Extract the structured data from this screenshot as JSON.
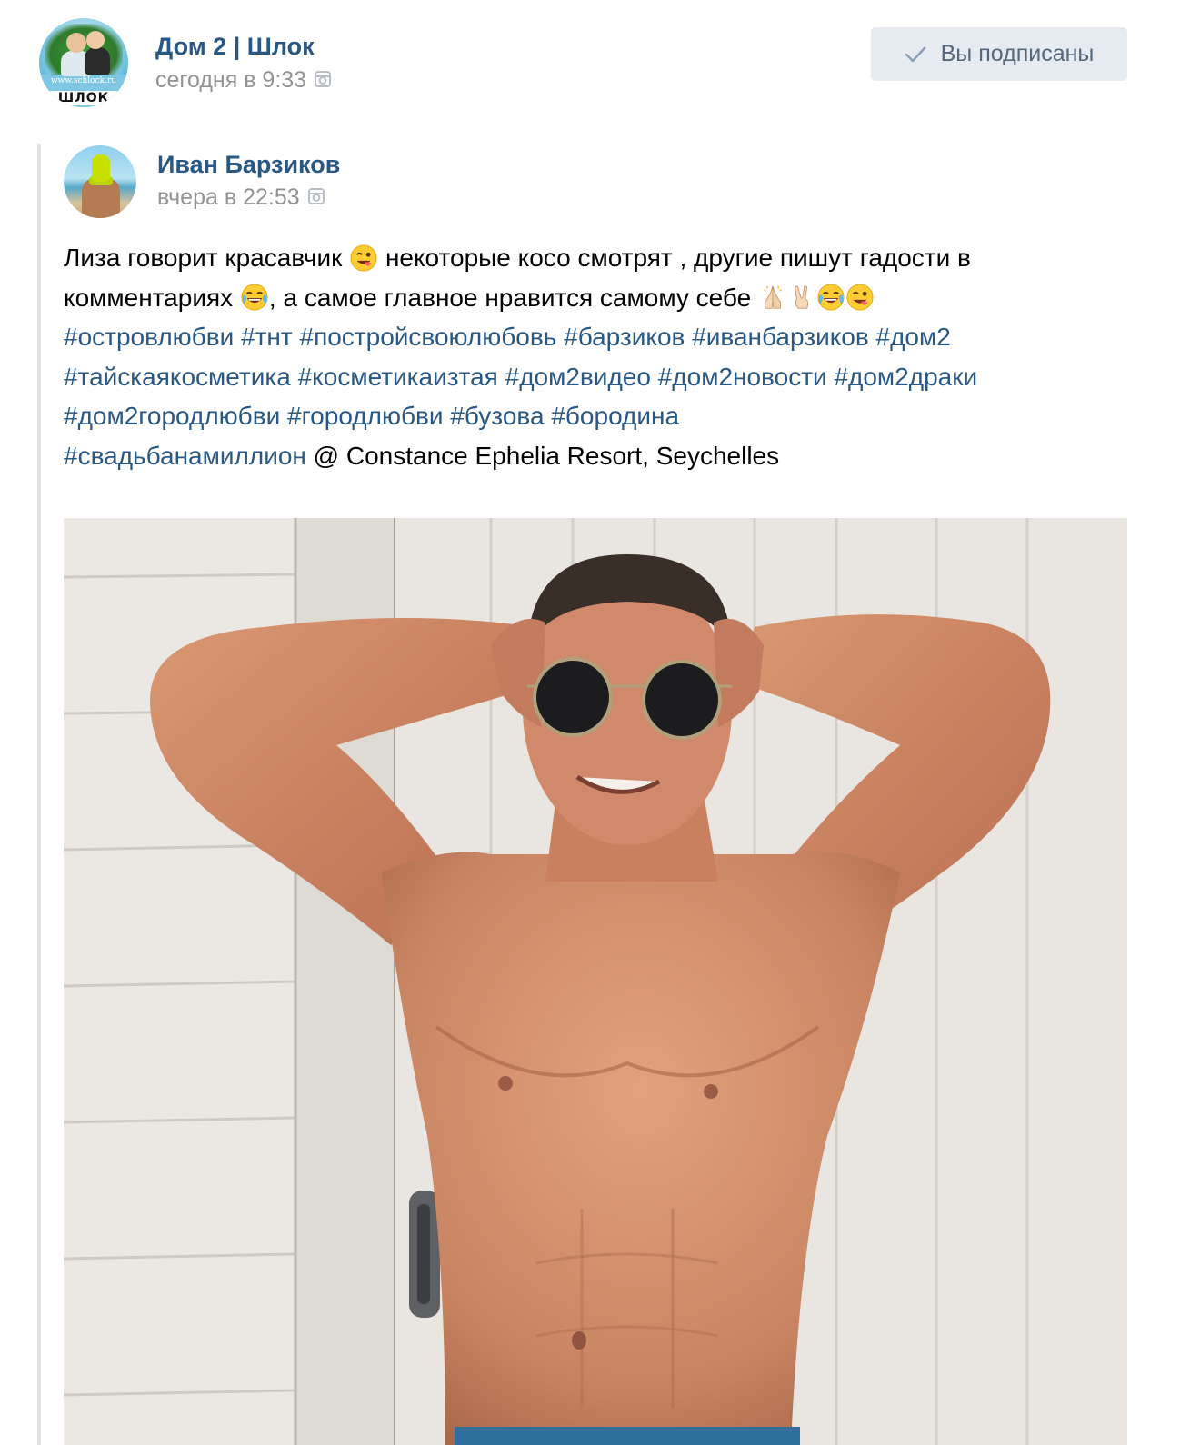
{
  "group": {
    "name": "Дом 2 | Шлок",
    "time": "сегодня в 9:33",
    "avatar_label": "ШЛОК",
    "avatar_site": "www.schlock.ru",
    "subscribe_label": "Вы подписаны"
  },
  "author": {
    "name": "Иван Барзиков",
    "time": "вчера в 22:53"
  },
  "post": {
    "line1": {
      "a": "Лиза говорит красавчик ",
      "b": " некоторые косо смотрят , другие пишут гадости в"
    },
    "line2": {
      "a": "комментариях ",
      "b": ", а самое главное нравится самому себе "
    },
    "hashtags": [
      "#островлюбви",
      "#тнт",
      "#постройсвоюлюбовь",
      "#барзиков",
      "#иванбарзиков",
      "#дом2",
      "#тайскаякосметика",
      "#косметикаизтая",
      "#дом2видео",
      "#дом2новости",
      "#дом2драки",
      "#дом2городлюбви",
      "#городлюбви",
      "#бузова",
      "#бородина",
      "#свадьбанамиллион"
    ],
    "location": " @ Constance Ephelia Resort, Seychelles"
  },
  "icons": {
    "instagram": "instagram-icon",
    "check": "check-icon",
    "emoji_wink_tongue": "winking-face-with-tongue-icon",
    "emoji_joy": "face-with-tears-of-joy-icon",
    "emoji_pray": "folded-hands-icon",
    "emoji_victory": "victory-hand-icon"
  },
  "colors": {
    "link": "#2a5885",
    "meta": "#939393",
    "button_bg": "#e5ebf1",
    "button_text": "#55677d",
    "repost_bar": "#dce1e6"
  }
}
